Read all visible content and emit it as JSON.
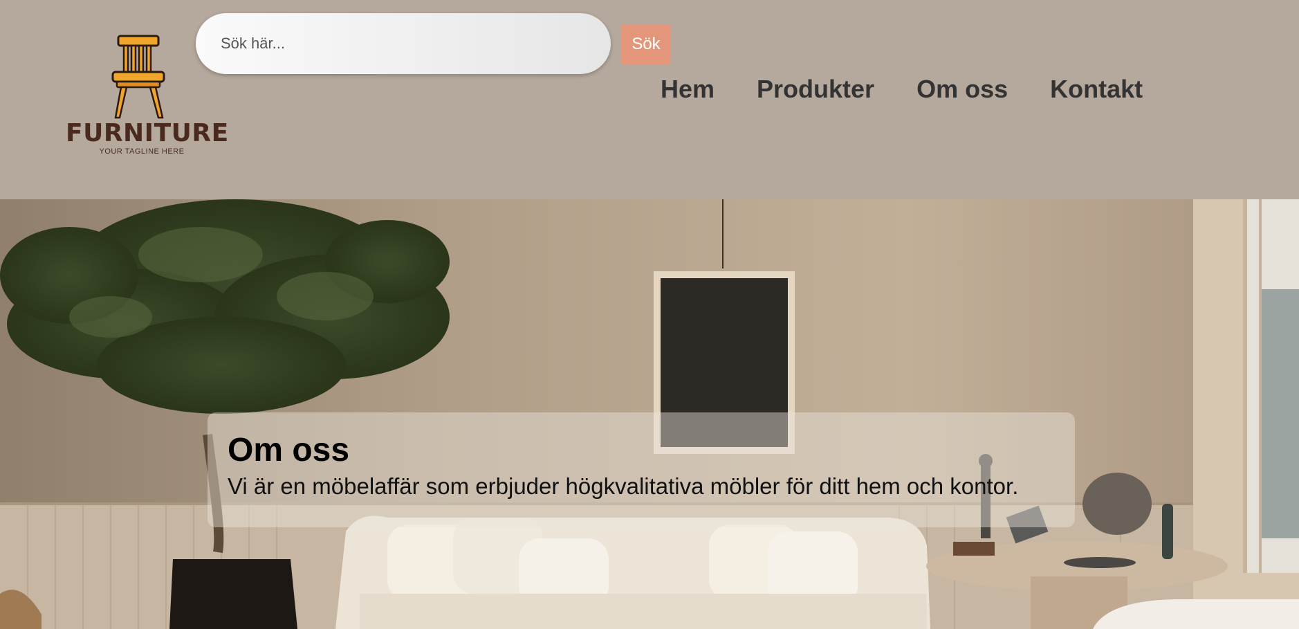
{
  "brand": {
    "name": "FURNITURE",
    "tagline": "YOUR TAGLINE HERE",
    "logo_icon": "chair-icon"
  },
  "search": {
    "placeholder": "Sök här...",
    "value": "",
    "button_label": "Sök"
  },
  "nav": {
    "items": [
      {
        "label": "Hem"
      },
      {
        "label": "Produkter"
      },
      {
        "label": "Om oss"
      },
      {
        "label": "Kontakt"
      }
    ]
  },
  "about": {
    "title": "Om oss",
    "text": "Vi är en möbelaffär som erbjuder högkvalitativa möbler för ditt hem och kontor."
  },
  "colors": {
    "header_bg": "#b5a89c",
    "search_button_bg": "#e3967a",
    "brand_text": "#4a2a1e",
    "chair_accent": "#f0a52b"
  }
}
